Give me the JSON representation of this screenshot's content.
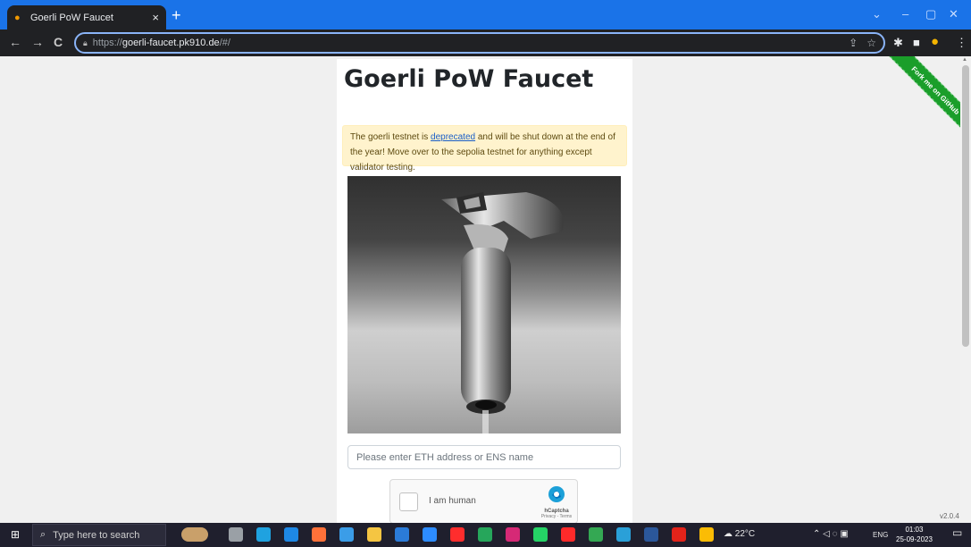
{
  "browser": {
    "tab": {
      "title": "Goerli PoW Faucet",
      "close": "×",
      "new": "+"
    },
    "window_controls": {
      "dropdown": "⌄",
      "minimize": "–",
      "maximize": "▢",
      "close": "✕"
    },
    "nav": {
      "back": "←",
      "forward": "→",
      "reload": "C"
    },
    "omnibox": {
      "scheme": "https://",
      "host": "goerli-faucet.pk910.de",
      "path": "/#/"
    },
    "omnibox_icons": [
      "share-icon",
      "star-icon"
    ],
    "toolbar_icons": [
      "extensions-icon",
      "sidepanel-icon",
      "profile-icon",
      "menu-icon"
    ]
  },
  "page": {
    "title": "Goerli PoW Faucet",
    "notice": {
      "before": "The goerli testnet is ",
      "link": "deprecated",
      "after": " and will be shut down at the end of the year! Move over to the sepolia testnet for anything except validator testing."
    },
    "address_input": {
      "value": "",
      "placeholder": "Please enter ETH address or ENS name"
    },
    "captcha": {
      "label": "I am human",
      "brand": "hCaptcha",
      "links": "Privacy - Terms"
    },
    "ribbon": "Fork me on GitHub",
    "version": "v2.0.4"
  },
  "taskbar": {
    "search_placeholder": "Type here to search",
    "apps": [
      {
        "name": "task-view",
        "color": "#9aa0a6"
      },
      {
        "name": "edge",
        "color": "#1fa2e0"
      },
      {
        "name": "mail",
        "color": "#1e88e5"
      },
      {
        "name": "firefox",
        "color": "#ff7139"
      },
      {
        "name": "vscode",
        "color": "#3b9de8"
      },
      {
        "name": "file-explorer",
        "color": "#f5c542"
      },
      {
        "name": "store",
        "color": "#2b7bd8"
      },
      {
        "name": "dropbox",
        "color": "#2d8cff"
      },
      {
        "name": "youtube",
        "color": "#ff2d2d"
      },
      {
        "name": "app-green",
        "color": "#26a65b"
      },
      {
        "name": "instagram",
        "color": "#d62976"
      },
      {
        "name": "whatsapp",
        "color": "#25d366"
      },
      {
        "name": "opera",
        "color": "#ff2a2a"
      },
      {
        "name": "chrome",
        "color": "#34a853"
      },
      {
        "name": "photos",
        "color": "#2aa0d8"
      },
      {
        "name": "word",
        "color": "#2b579a"
      },
      {
        "name": "acrobat",
        "color": "#e2231a"
      },
      {
        "name": "chrome-2",
        "color": "#fbbc05"
      }
    ],
    "weather": "22°C",
    "lang": "ENG",
    "time": "01:03",
    "date": "25-09-2023"
  }
}
